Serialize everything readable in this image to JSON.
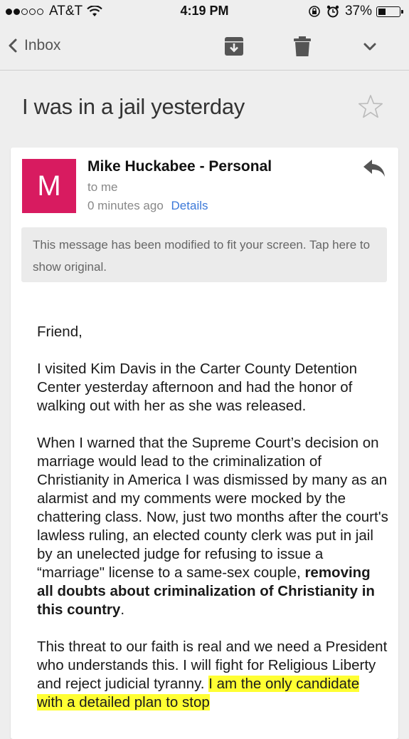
{
  "status_bar": {
    "carrier": "AT&T",
    "time": "4:19 PM",
    "battery_percent": "37%",
    "battery_level": 0.37,
    "signal_bars_filled": 2,
    "signal_bars_total": 5
  },
  "toolbar": {
    "back_label": "Inbox",
    "archive_icon": "archive-icon",
    "trash_icon": "trash-icon",
    "more_icon": "chevron-down-icon"
  },
  "email": {
    "subject": "I was in a jail yesterday",
    "avatar_letter": "M",
    "avatar_color": "#d81b60",
    "sender": "Mike Huckabee - Personal",
    "recipient": "to me",
    "time": "0 minutes ago",
    "details_link": "Details",
    "notice": "This message has been modified to fit your screen. Tap here to show original.",
    "body": {
      "greeting": "Friend,",
      "p1": "I visited Kim Davis in the Carter County Detention Center yesterday afternoon and had the honor of walking out with her as she was released.",
      "p2_text": "When I warned that the Supreme Court’s decision on marriage would lead to the criminalization of Christianity in America I was dismissed by many as an alarmist and my comments were mocked by the chattering class. Now, just two months after the court's lawless ruling, an elected county clerk was put in jail by an unelected judge for refusing to issue a “marriage\" license to a same-sex couple, ",
      "p2_bold": "removing all doubts about criminalization of Christianity in this country",
      "p2_end": ".",
      "p3_text": "This threat to our faith is real and we need a President who understands this. I will fight for Religious Liberty and reject judicial tyranny. ",
      "p3_highlight": "I am the only candidate with a detailed plan to stop"
    }
  },
  "colors": {
    "link": "#3b78d8",
    "highlight": "#ffff33",
    "background": "#eeeeee"
  }
}
